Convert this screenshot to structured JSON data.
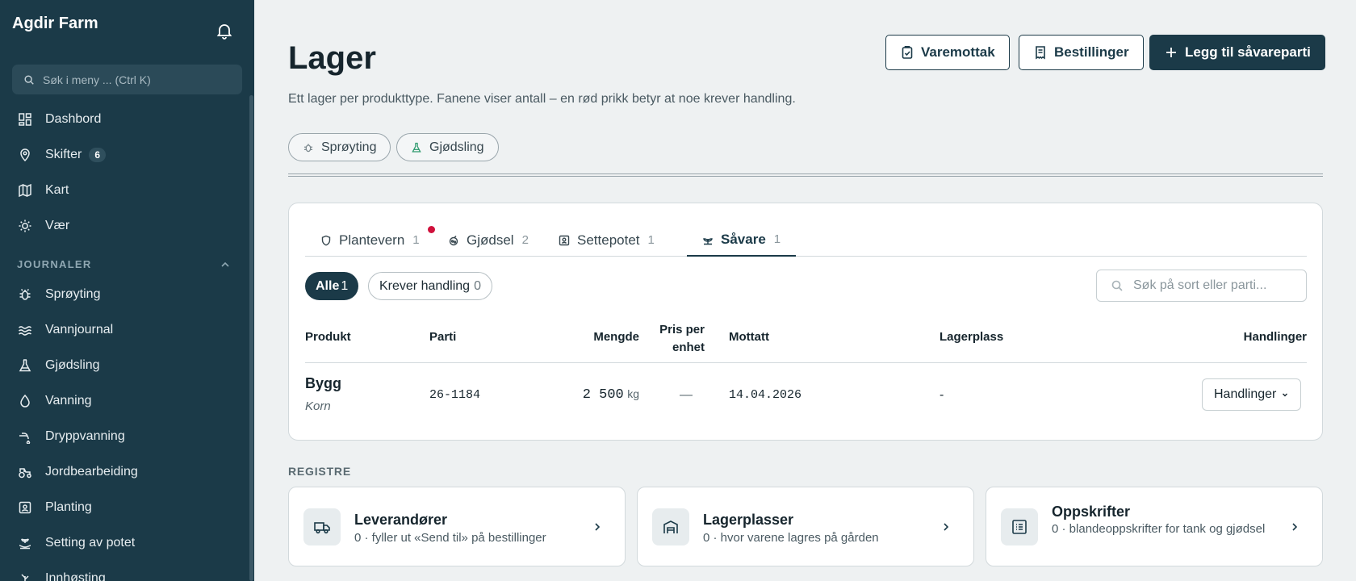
{
  "sidebar": {
    "brand": "Agdir Farm",
    "search_placeholder": "Søk i meny ... (Ctrl K)",
    "main_items": [
      {
        "label": "Dashbord",
        "icon": "grid-icon"
      },
      {
        "label": "Skifter",
        "icon": "map-pin-icon",
        "badge": "6"
      },
      {
        "label": "Kart",
        "icon": "map-icon"
      },
      {
        "label": "Vær",
        "icon": "sun-icon"
      }
    ],
    "section_label": "JOURNALER",
    "journal_items": [
      {
        "label": "Sprøyting",
        "icon": "bug-icon"
      },
      {
        "label": "Vannjournal",
        "icon": "waves-icon"
      },
      {
        "label": "Gjødsling",
        "icon": "flask-icon"
      },
      {
        "label": "Vanning",
        "icon": "droplet-icon"
      },
      {
        "label": "Dryppvanning",
        "icon": "drip-icon"
      },
      {
        "label": "Jordbearbeiding",
        "icon": "tractor-icon"
      },
      {
        "label": "Planting",
        "icon": "seed-box-icon"
      },
      {
        "label": "Setting av potet",
        "icon": "sprout-hand-icon"
      },
      {
        "label": "Innhøsting",
        "icon": "harvest-icon"
      }
    ]
  },
  "header": {
    "title": "Lager",
    "subtitle": "Ett lager per produkttype. Fanene viser antall – en rød prikk betyr at noe krever handling.",
    "buttons": {
      "receipt": "Varemottak",
      "orders": "Bestillinger",
      "add": "Legg til såvareparti"
    }
  },
  "chips": [
    {
      "label": "Sprøyting",
      "icon": "bug-icon"
    },
    {
      "label": "Gjødsling",
      "icon": "flask-icon"
    }
  ],
  "tabs": [
    {
      "label": "Plantevern",
      "count": "1",
      "icon": "shield-icon",
      "alert": true
    },
    {
      "label": "Gjødsel",
      "count": "2",
      "icon": "fertilizer-icon"
    },
    {
      "label": "Settepotet",
      "count": "1",
      "icon": "potato-box-icon"
    },
    {
      "label": "Såvare",
      "count": "1",
      "icon": "sprout-icon",
      "active": true
    }
  ],
  "filters": {
    "all_label": "Alle",
    "all_count": "1",
    "action_label": "Krever handling",
    "action_count": "0"
  },
  "table_search_placeholder": "Søk på sort eller parti...",
  "table": {
    "headers": {
      "product": "Produkt",
      "lot": "Parti",
      "amount": "Mengde",
      "price_1": "Pris per",
      "price_2": "enhet",
      "received": "Mottatt",
      "location": "Lagerplass",
      "actions": "Handlinger"
    },
    "rows": [
      {
        "product": "Bygg",
        "category": "Korn",
        "lot": "26-1184",
        "amount": "2 500",
        "unit": "kg",
        "price": "—",
        "received": "14.04.2026",
        "location": "-",
        "action_label": "Handlinger"
      }
    ]
  },
  "registers": {
    "heading": "REGISTRE",
    "cards": [
      {
        "title": "Leverandører",
        "desc": "0 · fyller ut «Send til» på bestillinger",
        "icon": "truck-icon"
      },
      {
        "title": "Lagerplasser",
        "desc": "0 · hvor varene lagres på gården",
        "icon": "warehouse-icon"
      },
      {
        "title": "Oppskrifter",
        "desc": "0 · blandeoppskrifter for tank og gjødsel",
        "icon": "list-icon"
      }
    ]
  },
  "colors": {
    "sidebar_bg": "#1b3a48",
    "accent": "#1b3a48",
    "alert_dot": "#d0113c",
    "page_bg": "#eef1f2"
  }
}
